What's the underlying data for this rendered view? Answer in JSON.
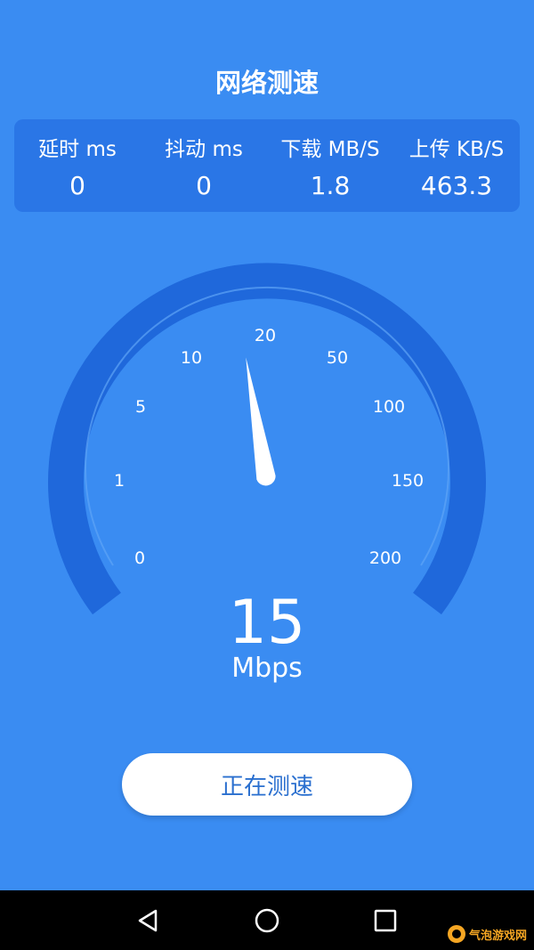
{
  "app": {
    "title": "网络测速"
  },
  "stats": [
    {
      "label": "延时 ms",
      "value": "0"
    },
    {
      "label": "抖动 ms",
      "value": "0"
    },
    {
      "label": "下载 MB/S",
      "value": "1.8"
    },
    {
      "label": "上传 KB/S",
      "value": "463.3"
    }
  ],
  "gauge": {
    "ticks": [
      "0",
      "1",
      "5",
      "10",
      "20",
      "50",
      "100",
      "150",
      "200"
    ],
    "needle_value": 15,
    "speed": "15",
    "unit": "Mbps"
  },
  "button": {
    "label": "正在测速"
  },
  "navbar": {
    "icons": [
      "back-icon",
      "home-icon",
      "recent-apps-icon"
    ]
  },
  "watermark": {
    "text": "气泡游戏网"
  },
  "colors": {
    "background": "#3a8cf2",
    "panel": "#2a76e6",
    "arc": "#1f68db",
    "nav": "#000000"
  }
}
